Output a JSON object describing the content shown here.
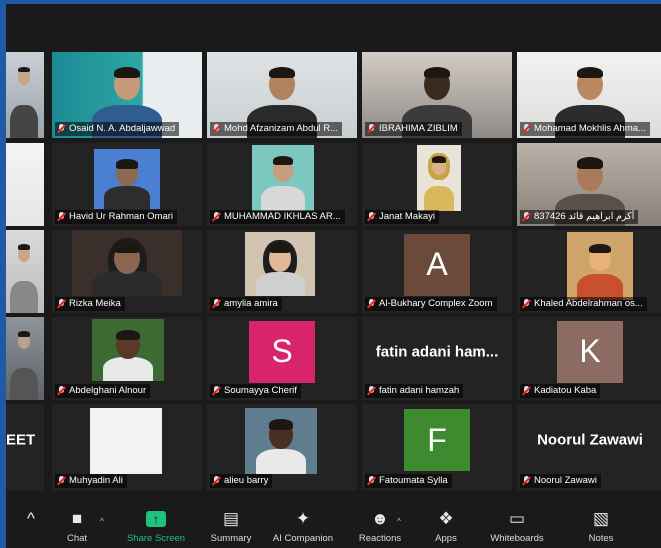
{
  "participants": [
    {
      "name": "",
      "kind": "video"
    },
    {
      "name": "Osaid N. A. Abdaljawwad",
      "kind": "video"
    },
    {
      "name": "Mohd Afzanizam Abdul R...",
      "kind": "video"
    },
    {
      "name": "IBRAHIMA ZIBLIM",
      "kind": "video"
    },
    {
      "name": "Mohamad Mokhlis Ahma...",
      "kind": "video"
    },
    {
      "name": "",
      "kind": "video"
    },
    {
      "name": "Havid Ur Rahman Omari",
      "kind": "video"
    },
    {
      "name": "MUHAMMAD IKHLAS AR...",
      "kind": "video"
    },
    {
      "name": "Janat Makayi",
      "kind": "video"
    },
    {
      "name": "أكرم ابراهيم قائد 837426",
      "kind": "video"
    },
    {
      "name": "",
      "kind": "video"
    },
    {
      "name": "Rizka Meika",
      "kind": "video"
    },
    {
      "name": "amylia amira",
      "kind": "video"
    },
    {
      "name": "Al-Bukhary Complex Zoom",
      "kind": "avatar",
      "initial": "A",
      "color": "#6b4a3c"
    },
    {
      "name": "Khaled Abdelrahman os...",
      "kind": "video"
    },
    {
      "name": "",
      "kind": "video"
    },
    {
      "name": "Abdelghani Alnour",
      "kind": "video"
    },
    {
      "name": "Soumayya Cherif",
      "kind": "avatar",
      "initial": "S",
      "color": "#d8246b"
    },
    {
      "name": "fatin adani hamzah",
      "kind": "text",
      "display": "fatin adani ham..."
    },
    {
      "name": "Kadiatou Kaba",
      "kind": "avatar",
      "initial": "K",
      "color": "#8b6b62"
    },
    {
      "name": "",
      "kind": "text",
      "display": "EET"
    },
    {
      "name": "Muhyadin Ali",
      "kind": "video"
    },
    {
      "name": "alieu barry",
      "kind": "video"
    },
    {
      "name": "Fatoumata Sylla",
      "kind": "avatar",
      "initial": "F",
      "color": "#3e8a2e"
    },
    {
      "name": "Noorul Zawawi",
      "kind": "text",
      "display": "Noorul Zawawi"
    }
  ],
  "toolbar": [
    {
      "label": "",
      "icon": "expand-icon"
    },
    {
      "label": "Chat",
      "icon": "chat-icon"
    },
    {
      "label": "Share Screen",
      "icon": "share-screen-icon"
    },
    {
      "label": "Summary",
      "icon": "summary-icon"
    },
    {
      "label": "AI Companion",
      "icon": "ai-companion-icon"
    },
    {
      "label": "Reactions",
      "icon": "reactions-icon"
    },
    {
      "label": "Apps",
      "icon": "apps-icon"
    },
    {
      "label": "Whiteboards",
      "icon": "whiteboards-icon"
    },
    {
      "label": "Notes",
      "icon": "notes-icon"
    }
  ],
  "colors": {
    "active_speaker": "#b9df5f",
    "share_green": "#1dc37d",
    "muted_mic": "#e22222"
  }
}
